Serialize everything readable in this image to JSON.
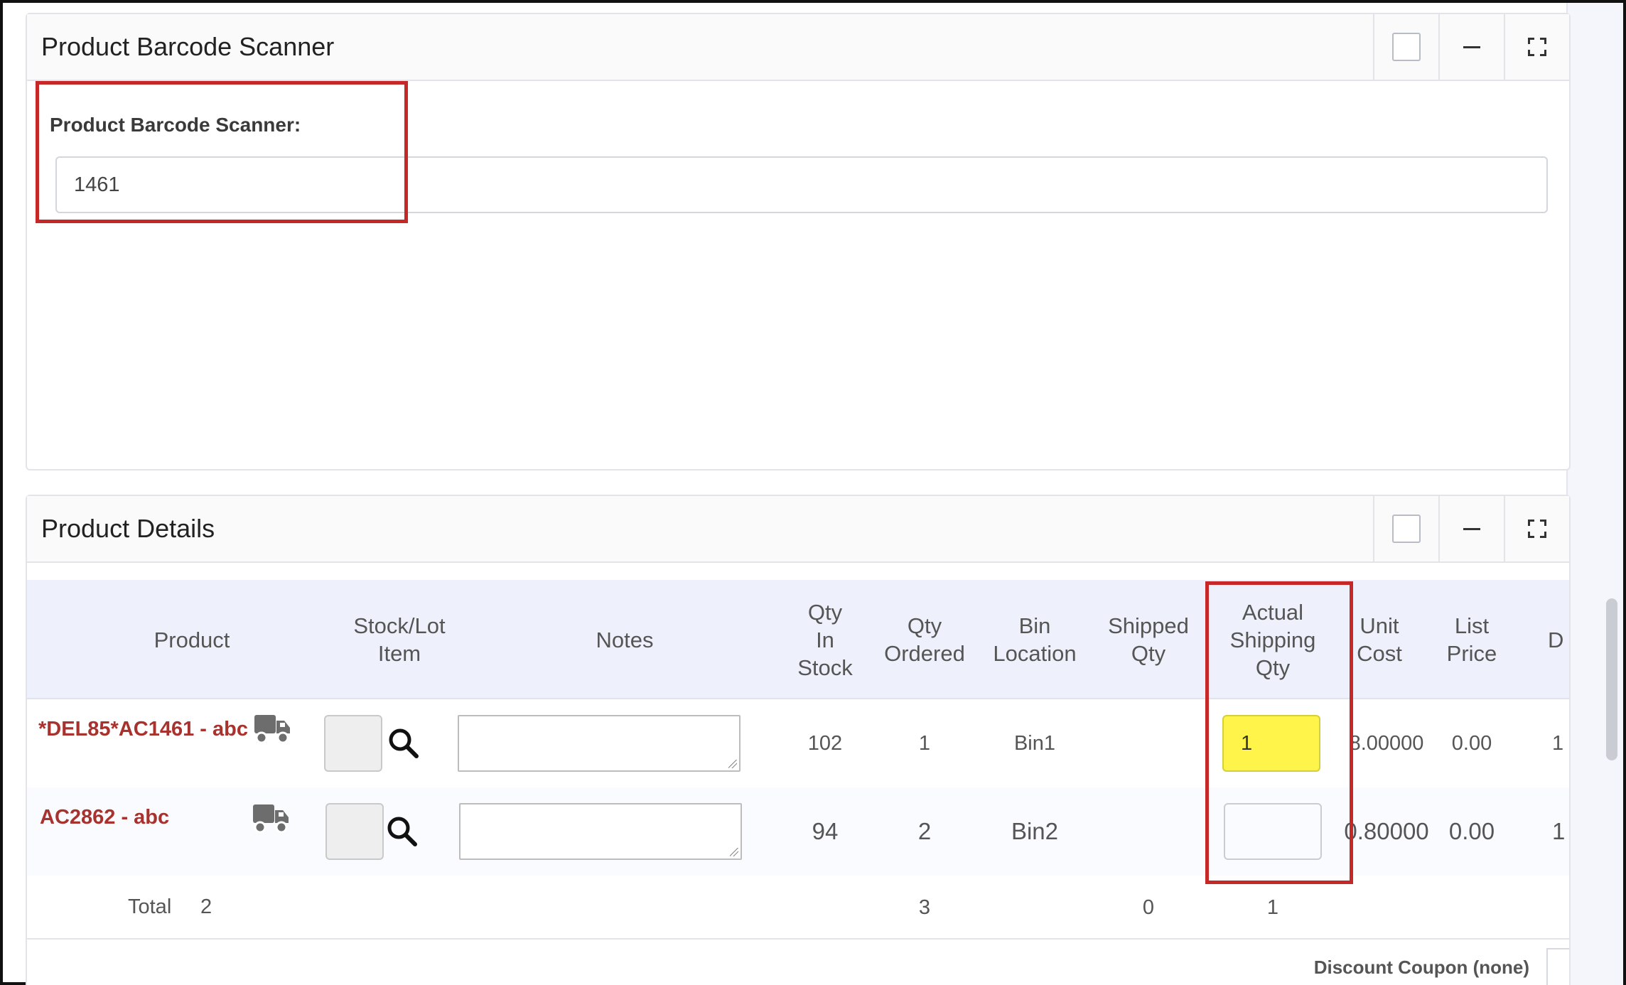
{
  "scanner_panel": {
    "title": "Product Barcode Scanner",
    "label": "Product Barcode Scanner:",
    "input_value": "1461"
  },
  "details_panel": {
    "title": "Product Details",
    "columns": {
      "product": "Product",
      "stock_lot": "Stock/Lot\nItem",
      "notes": "Notes",
      "qty_in_stock": "Qty\nIn\nStock",
      "qty_ordered": "Qty\nOrdered",
      "bin_location": "Bin\nLocation",
      "shipped_qty": "Shipped\nQty",
      "actual_shipping_qty": "Actual\nShipping\nQty",
      "unit_cost": "Unit\nCost",
      "list_price": "List\nPrice",
      "d": "D"
    },
    "rows": [
      {
        "product": "*DEL85*AC1461 - abc",
        "qty_in_stock": "102",
        "qty_ordered": "1",
        "bin_location": "Bin1",
        "shipped_qty": "",
        "actual_shipping_qty": "1",
        "unit_cost": "8.00000",
        "list_price": "0.00",
        "d": "1"
      },
      {
        "product": "AC2862 - abc",
        "qty_in_stock": "94",
        "qty_ordered": "2",
        "bin_location": "Bin2",
        "shipped_qty": "",
        "actual_shipping_qty": "",
        "unit_cost": "0.80000",
        "list_price": "0.00",
        "d": "1"
      }
    ],
    "total": {
      "label": "Total",
      "count": "2",
      "qty_ordered": "3",
      "shipped_qty": "0",
      "actual_shipping_qty": "1"
    },
    "discount_coupon": "Discount Coupon (none)"
  },
  "colors": {
    "highlight": "#c62828",
    "product_link": "#a8322d",
    "filled_qty": "#fff44a",
    "table_header_bg": "#eef1fb"
  }
}
